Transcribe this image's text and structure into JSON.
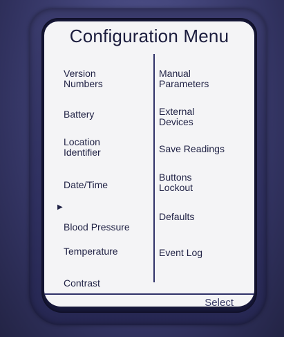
{
  "screen": {
    "title": "Configuration Menu",
    "left_items": [
      {
        "label": "Version\nNumbers"
      },
      {
        "label": "Battery"
      },
      {
        "label": "Location\nIdentifier"
      },
      {
        "label": "Date/Time"
      },
      {
        "label": "Blood Pressure",
        "selected": true
      },
      {
        "label": "Temperature"
      },
      {
        "label": "Contrast"
      }
    ],
    "right_items": [
      {
        "label": "Manual\nParameters"
      },
      {
        "label": "External\nDevices"
      },
      {
        "label": "Save Readings"
      },
      {
        "label": "Buttons\nLockout"
      },
      {
        "label": "Defaults"
      },
      {
        "label": "Event Log"
      }
    ],
    "softkey_label": "Select",
    "selection_indicator": "▶"
  },
  "colors": {
    "screen_bg": "#f4f4f6",
    "device_body": "#44467c",
    "text": "#1f2144"
  }
}
